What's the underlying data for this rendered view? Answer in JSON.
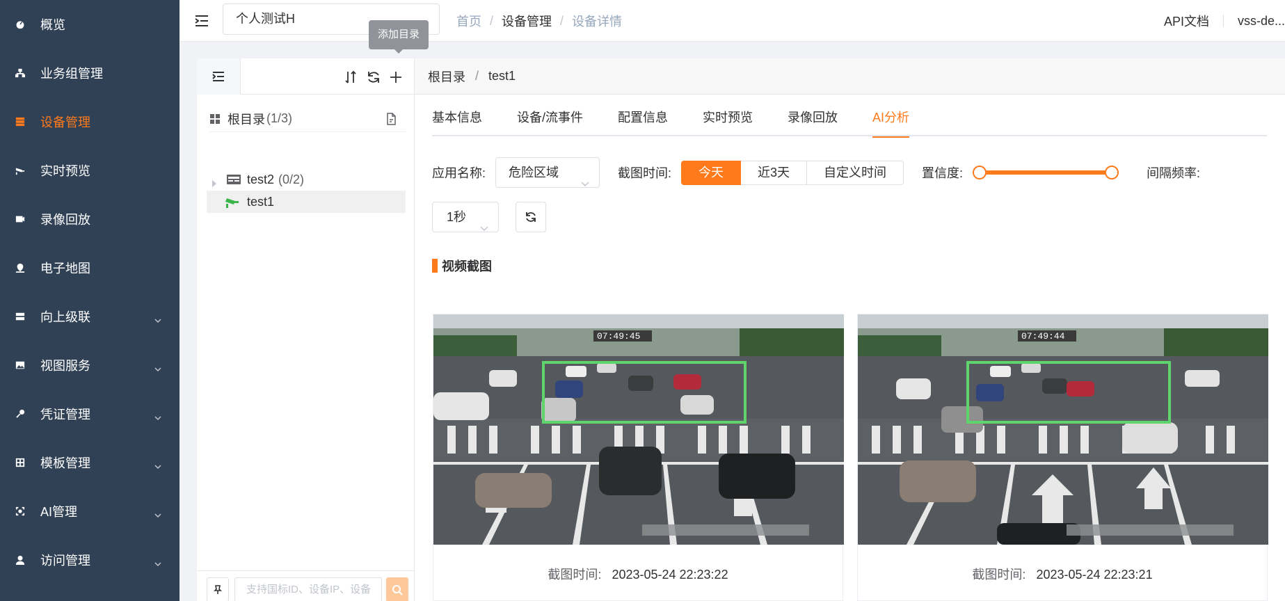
{
  "sidebar": {
    "items": [
      {
        "label": "概览",
        "icon": "dashboard-icon",
        "expandable": false,
        "active": false
      },
      {
        "label": "业务组管理",
        "icon": "network-icon",
        "expandable": false,
        "active": false
      },
      {
        "label": "设备管理",
        "icon": "list-icon",
        "expandable": false,
        "active": true
      },
      {
        "label": "实时预览",
        "icon": "camera-icon",
        "expandable": false,
        "active": false
      },
      {
        "label": "录像回放",
        "icon": "video-icon",
        "expandable": false,
        "active": false
      },
      {
        "label": "电子地图",
        "icon": "map-pin-icon",
        "expandable": false,
        "active": false
      },
      {
        "label": "向上级联",
        "icon": "server-icon",
        "expandable": true,
        "active": false
      },
      {
        "label": "视图服务",
        "icon": "image-icon",
        "expandable": true,
        "active": false
      },
      {
        "label": "凭证管理",
        "icon": "key-icon",
        "expandable": true,
        "active": false
      },
      {
        "label": "模板管理",
        "icon": "template-icon",
        "expandable": true,
        "active": false
      },
      {
        "label": "AI管理",
        "icon": "ai-icon",
        "expandable": true,
        "active": false
      },
      {
        "label": "访问管理",
        "icon": "user-icon",
        "expandable": true,
        "active": false
      }
    ]
  },
  "header": {
    "project": "个人测试H",
    "breadcrumb": [
      "首页",
      "设备管理",
      "设备详情"
    ],
    "api_doc": "API文档",
    "user": "vss-de..."
  },
  "tooltip": "添加目录",
  "tree": {
    "root_label": "根目录",
    "root_count": "(1/3)",
    "nodes": [
      {
        "label": "test2",
        "count": "(0/2)"
      },
      {
        "label": "test1",
        "count": ""
      }
    ],
    "search_placeholder": "支持国标ID、设备IP、设备"
  },
  "main": {
    "crumb": [
      "根目录",
      "test1"
    ],
    "tabs": [
      {
        "label": "基本信息",
        "active": false
      },
      {
        "label": "设备/流事件",
        "active": false
      },
      {
        "label": "配置信息",
        "active": false
      },
      {
        "label": "实时预览",
        "active": false
      },
      {
        "label": "录像回放",
        "active": false
      },
      {
        "label": "AI分析",
        "active": true
      }
    ],
    "filters": {
      "app_label": "应用名称:",
      "app_value": "危险区域",
      "time_label": "截图时间:",
      "time_options": [
        "今天",
        "近3天",
        "自定义时间"
      ],
      "time_active": "今天",
      "confidence_label": "置信度:",
      "confidence_range": [
        0,
        1
      ],
      "interval_label": "间隔频率:",
      "interval_value": "1秒"
    },
    "section_title": "视频截图",
    "snapshots": [
      {
        "overlay_time": "07:49:45",
        "time_label": "截图时间:",
        "time": "2023-05-24 22:23:22"
      },
      {
        "overlay_time": "07:49:44",
        "time_label": "截图时间:",
        "time": "2023-05-24 22:23:21"
      }
    ]
  },
  "colors": {
    "sidebar_bg": "#304156",
    "accent": "#ff7a1a",
    "detect_box": "#5fd46a"
  }
}
